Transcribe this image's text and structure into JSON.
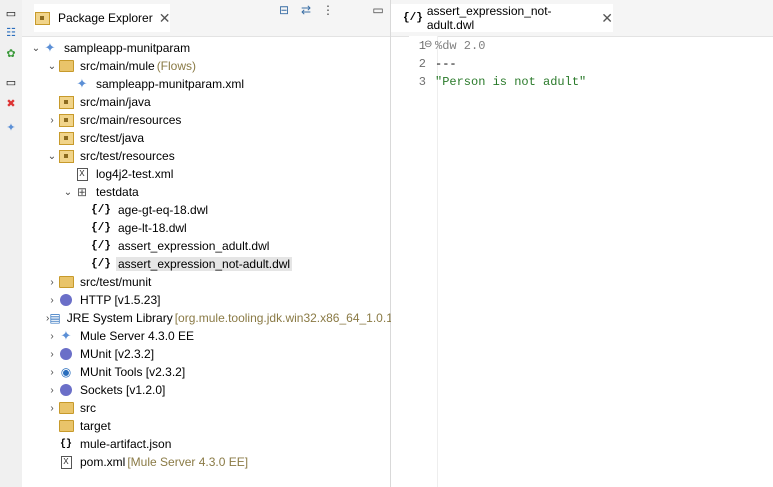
{
  "package_explorer": {
    "tab_label": "Package Explorer",
    "tree": [
      {
        "label": "sampleapp-munitparam",
        "icon": "mule-project-icon",
        "twisty": "open"
      },
      {
        "label": "src/main/mule",
        "decoration": "(Flows)",
        "icon": "source-folder-icon",
        "twisty": "open"
      },
      {
        "label": "sampleapp-munitparam.xml",
        "icon": "mule-config-icon",
        "twisty": ""
      },
      {
        "label": "src/main/java",
        "icon": "package-folder-icon",
        "twisty": ""
      },
      {
        "label": "src/main/resources",
        "icon": "package-folder-icon",
        "twisty": "closed"
      },
      {
        "label": "src/test/java",
        "icon": "package-folder-icon",
        "twisty": ""
      },
      {
        "label": "src/test/resources",
        "icon": "package-folder-icon",
        "twisty": "open"
      },
      {
        "label": "log4j2-test.xml",
        "icon": "xml-file-icon",
        "twisty": ""
      },
      {
        "label": "testdata",
        "icon": "package-icon",
        "twisty": "open"
      },
      {
        "label": "age-gt-eq-18.dwl",
        "icon": "dwl-file-icon",
        "twisty": ""
      },
      {
        "label": "age-lt-18.dwl",
        "icon": "dwl-file-icon",
        "twisty": ""
      },
      {
        "label": "assert_expression_adult.dwl",
        "icon": "dwl-file-icon",
        "twisty": ""
      },
      {
        "label": "assert_expression_not-adult.dwl",
        "icon": "dwl-file-icon",
        "twisty": "",
        "selected": true
      },
      {
        "label": "src/test/munit",
        "icon": "source-folder-icon",
        "twisty": "closed"
      },
      {
        "label": "HTTP [v1.5.23]",
        "icon": "library-icon",
        "twisty": "closed"
      },
      {
        "label": "JRE System Library",
        "decoration": "[org.mule.tooling.jdk.win32.x86_64_1.0.1",
        "icon": "jre-library-icon",
        "twisty": "closed"
      },
      {
        "label": "Mule Server 4.3.0 EE",
        "icon": "mule-runtime-icon",
        "twisty": "closed"
      },
      {
        "label": "MUnit [v2.3.2]",
        "icon": "library-icon",
        "twisty": "closed"
      },
      {
        "label": "MUnit Tools [v2.3.2]",
        "icon": "munit-tools-icon",
        "twisty": "closed"
      },
      {
        "label": "Sockets [v1.2.0]",
        "icon": "library-icon",
        "twisty": "closed"
      },
      {
        "label": "src",
        "icon": "folder-icon",
        "twisty": "closed"
      },
      {
        "label": "target",
        "icon": "folder-icon",
        "twisty": ""
      },
      {
        "label": "mule-artifact.json",
        "icon": "json-file-icon",
        "twisty": ""
      },
      {
        "label": "pom.xml",
        "decoration": "[Mule Server 4.3.0 EE]",
        "icon": "xml-file-icon",
        "twisty": ""
      }
    ]
  },
  "editor": {
    "tab_label": "assert_expression_not-adult.dwl",
    "tab_prefix": "{/}",
    "lines": [
      {
        "num": "1",
        "text": "%dw 2.0"
      },
      {
        "num": "2",
        "text": "---"
      },
      {
        "num": "3",
        "text": "\"Person is not adult\""
      }
    ]
  }
}
